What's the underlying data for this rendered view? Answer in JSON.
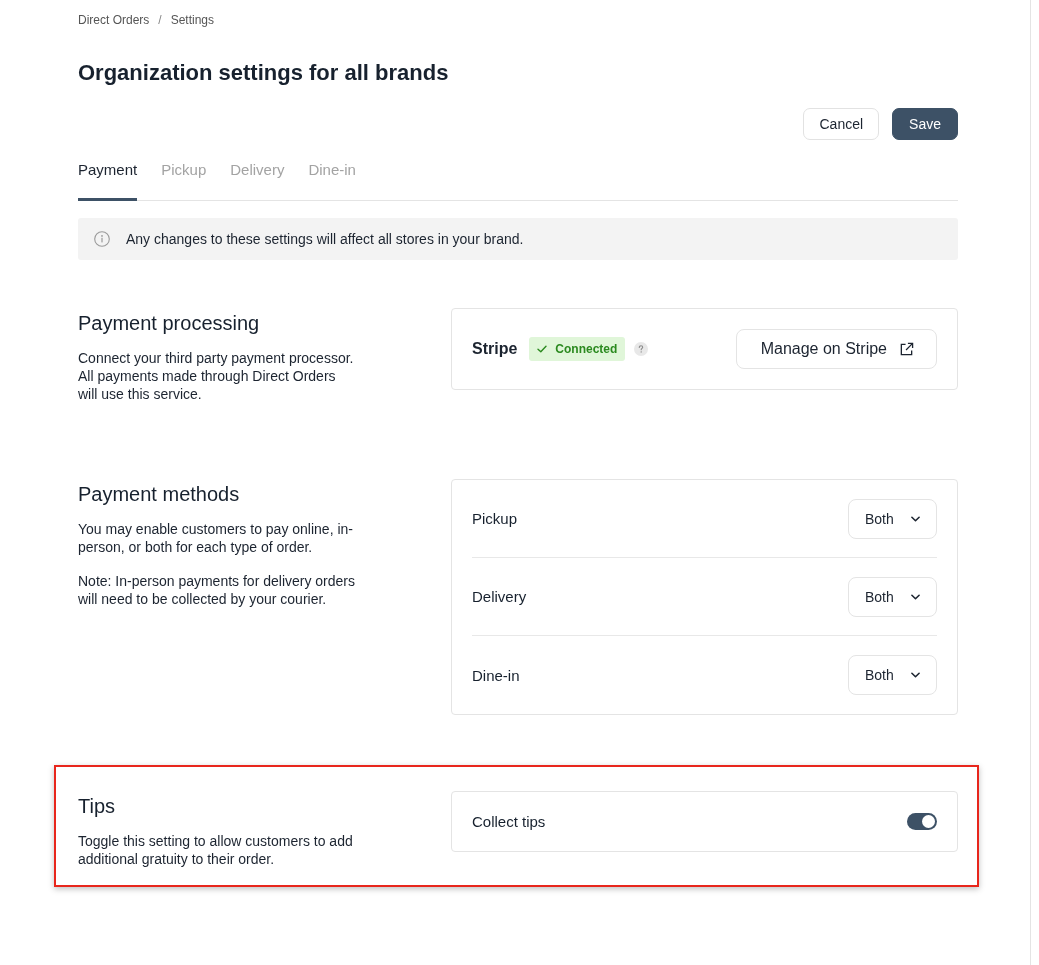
{
  "breadcrumb": {
    "items": [
      {
        "label": "Direct Orders"
      },
      {
        "label": "Settings"
      }
    ],
    "separator": "/"
  },
  "title": "Organization settings for all brands",
  "actions": [
    {
      "label": "Cancel",
      "kind": "secondary"
    },
    {
      "label": "Save",
      "kind": "primary"
    }
  ],
  "tabs": [
    {
      "label": "Payment",
      "selected": true
    },
    {
      "label": "Pickup",
      "selected": false
    },
    {
      "label": "Delivery",
      "selected": false
    },
    {
      "label": "Dine-in",
      "selected": false
    }
  ],
  "notice": {
    "text": "Any changes to these settings will affect all stores in your brand."
  },
  "sections": [
    {
      "title": "Payment processing",
      "description": [
        "Connect your third party payment processor. All payments made through Direct Orders will use this service."
      ],
      "highlighted": false,
      "card": {
        "kind": "provider",
        "name": "Stripe",
        "status": {
          "label": "Connected",
          "connected": true
        },
        "action": "Manage on Stripe"
      }
    },
    {
      "title": "Payment methods",
      "description": [
        "You may enable customers to pay online, in-person, or both for each type of order.",
        "Note: In-person payments for delivery orders will need to be collected by your courier."
      ],
      "highlighted": false,
      "card": {
        "kind": "selects",
        "rows": [
          {
            "label": "Pickup",
            "value": "Both"
          },
          {
            "label": "Delivery",
            "value": "Both"
          },
          {
            "label": "Dine-in",
            "value": "Both"
          }
        ]
      }
    },
    {
      "title": "Tips",
      "description": [
        "Toggle this setting to allow customers to add additional gratuity to their order."
      ],
      "highlighted": true,
      "card": {
        "kind": "toggles",
        "rows": [
          {
            "label": "Collect tips",
            "on": true
          }
        ]
      }
    }
  ]
}
